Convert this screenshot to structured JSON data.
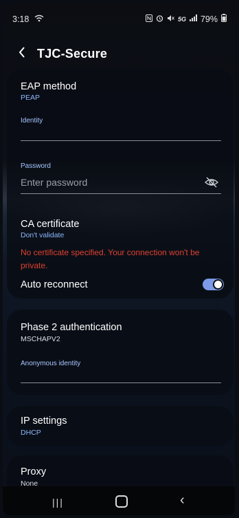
{
  "status": {
    "time": "3:18",
    "battery": "79%",
    "network": "5G"
  },
  "header": {
    "title": "TJC-Secure"
  },
  "eap": {
    "label": "EAP method",
    "value": "PEAP"
  },
  "identity": {
    "label": "Identity",
    "value": ""
  },
  "password": {
    "label": "Password",
    "placeholder": "Enter password"
  },
  "ca": {
    "label": "CA certificate",
    "value": "Don't validate",
    "warning": "No certificate specified. Your connection won't be private."
  },
  "auto_reconnect": {
    "label": "Auto reconnect",
    "enabled": true
  },
  "phase2": {
    "label": "Phase 2 authentication",
    "value": "MSCHAPV2"
  },
  "anonymous": {
    "label": "Anonymous identity",
    "value": ""
  },
  "ip": {
    "label": "IP settings",
    "value": "DHCP"
  },
  "proxy": {
    "label": "Proxy",
    "value": "None"
  },
  "navbar": {
    "recent_glyph": "|||",
    "back_glyph": "‹"
  },
  "colors": {
    "accent": "#8fb8ff",
    "warning": "#e0412f",
    "toggle": "#7b9be8"
  }
}
